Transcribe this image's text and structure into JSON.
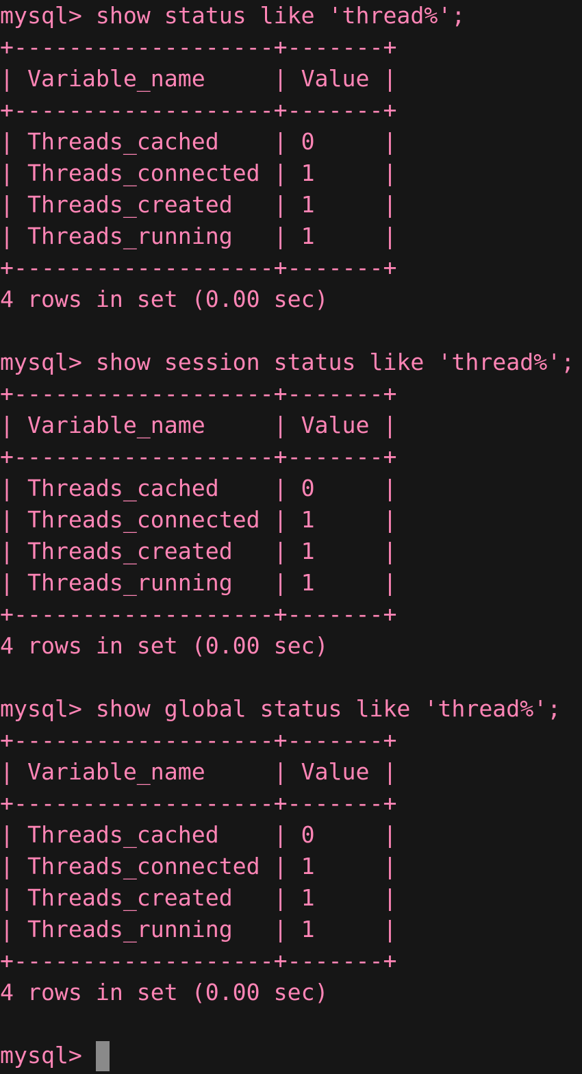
{
  "terminal": {
    "accent_color": "#ff85b6",
    "background_color": "#161616",
    "cursor_color": "#8a8a8a",
    "blocks": [
      {
        "command": "mysql> show status like 'thread%';",
        "table_lines": [
          "+-------------------+-------+",
          "| Variable_name     | Value |",
          "+-------------------+-------+",
          "| Threads_cached    | 0     |",
          "| Threads_connected | 1     |",
          "| Threads_created   | 1     |",
          "| Threads_running   | 1     |",
          "+-------------------+-------+"
        ],
        "result_summary": "4 rows in set (0.00 sec)"
      },
      {
        "command": "mysql> show session status like 'thread%';",
        "table_lines": [
          "+-------------------+-------+",
          "| Variable_name     | Value |",
          "+-------------------+-------+",
          "| Threads_cached    | 0     |",
          "| Threads_connected | 1     |",
          "| Threads_created   | 1     |",
          "| Threads_running   | 1     |",
          "+-------------------+-------+"
        ],
        "result_summary": "4 rows in set (0.00 sec)"
      },
      {
        "command": "mysql> show global status like 'thread%';",
        "table_lines": [
          "+-------------------+-------+",
          "| Variable_name     | Value |",
          "+-------------------+-------+",
          "| Threads_cached    | 0     |",
          "| Threads_connected | 1     |",
          "| Threads_created   | 1     |",
          "| Threads_running   | 1     |",
          "+-------------------+-------+"
        ],
        "result_summary": "4 rows in set (0.00 sec)"
      }
    ],
    "current_prompt": "mysql> "
  }
}
